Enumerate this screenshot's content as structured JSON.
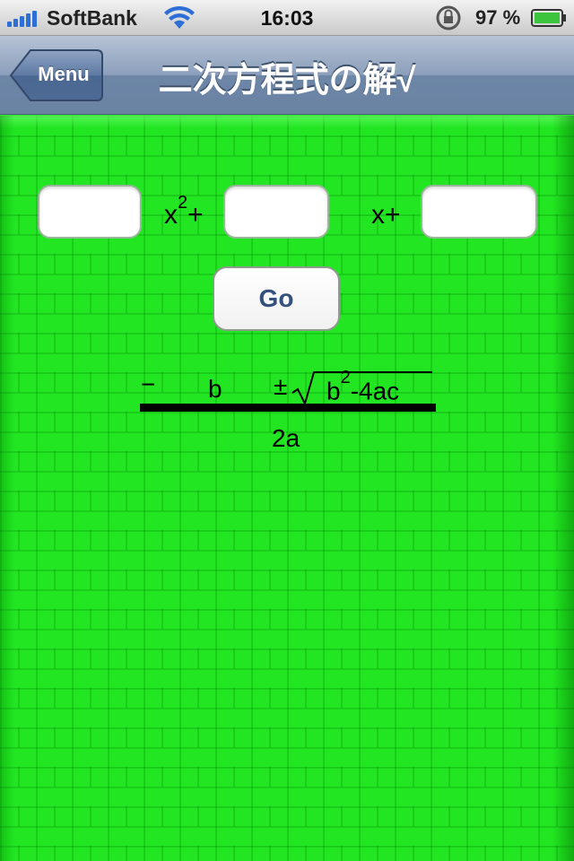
{
  "status_bar": {
    "carrier": "SoftBank",
    "time": "16:03",
    "battery_percent": "97 %",
    "icons": [
      "signal-bars-icon",
      "wifi-icon",
      "rotation-lock-icon",
      "battery-icon"
    ]
  },
  "nav_bar": {
    "back_label": "Menu",
    "title": "二次方程式の解√"
  },
  "equation": {
    "a_value": "",
    "b_value": "",
    "c_value": "",
    "x_squared_base": "x",
    "x_squared_exp": "2",
    "x_squared_plus": "+",
    "x_plus": "x+"
  },
  "go_button": {
    "label": "Go"
  },
  "formula": {
    "minus": "−",
    "b": "b",
    "plus_minus": "±",
    "radicand_b": "b",
    "radicand_exp": "2",
    "radicand_rest": "-4ac",
    "denominator": "2a"
  },
  "colors": {
    "background_green": "#21e621",
    "nav_blue": "#6d86a7",
    "button_text": "#34507d"
  }
}
